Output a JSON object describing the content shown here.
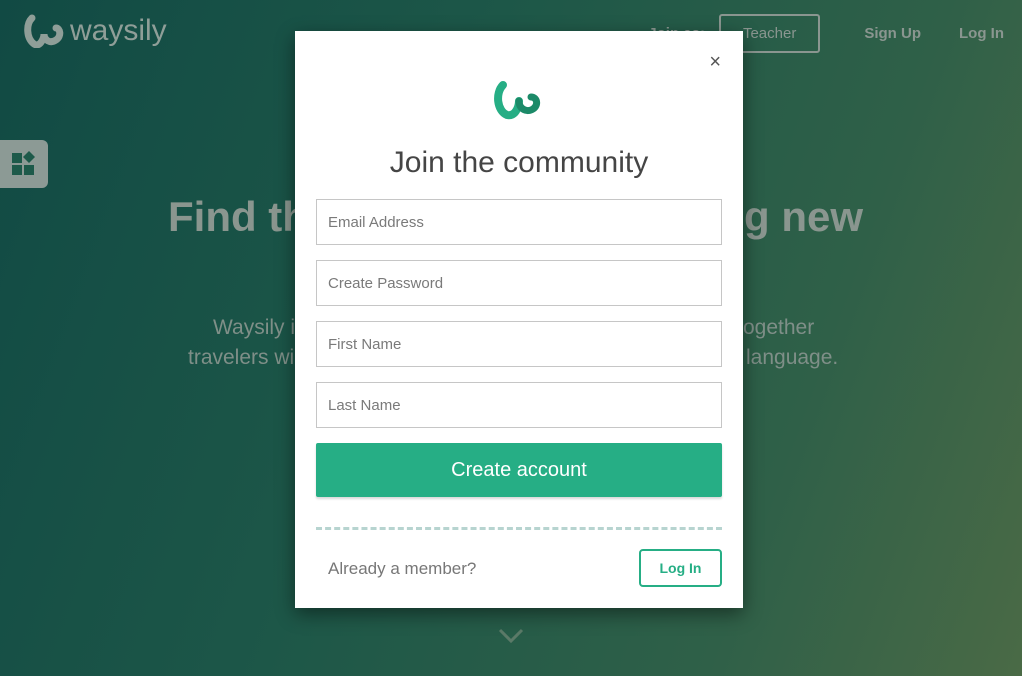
{
  "header": {
    "brand": "waysily",
    "nav": {
      "join_as": "Join as:",
      "teacher": "Teacher",
      "sign_up": "Sign Up",
      "log_in": "Log In"
    }
  },
  "background": {
    "headline_left": "Find th",
    "headline_right": "g new",
    "para_line1_left": "Waysily i",
    "para_line1_right": "ogether",
    "para_line2_left": "travelers wi",
    "para_line2_right": "language."
  },
  "modal": {
    "title": "Join the community",
    "fields": [
      {
        "placeholder": "Email Address",
        "value": ""
      },
      {
        "placeholder": "Create Password",
        "value": ""
      },
      {
        "placeholder": "First Name",
        "value": ""
      },
      {
        "placeholder": "Last Name",
        "value": ""
      }
    ],
    "create_label": "Create account",
    "already_member": "Already a member?",
    "login_label": "Log In",
    "close_glyph": "×"
  },
  "colors": {
    "accent": "#26ae85",
    "bg_start": "#114a44",
    "bg_end": "#4a6a46"
  }
}
